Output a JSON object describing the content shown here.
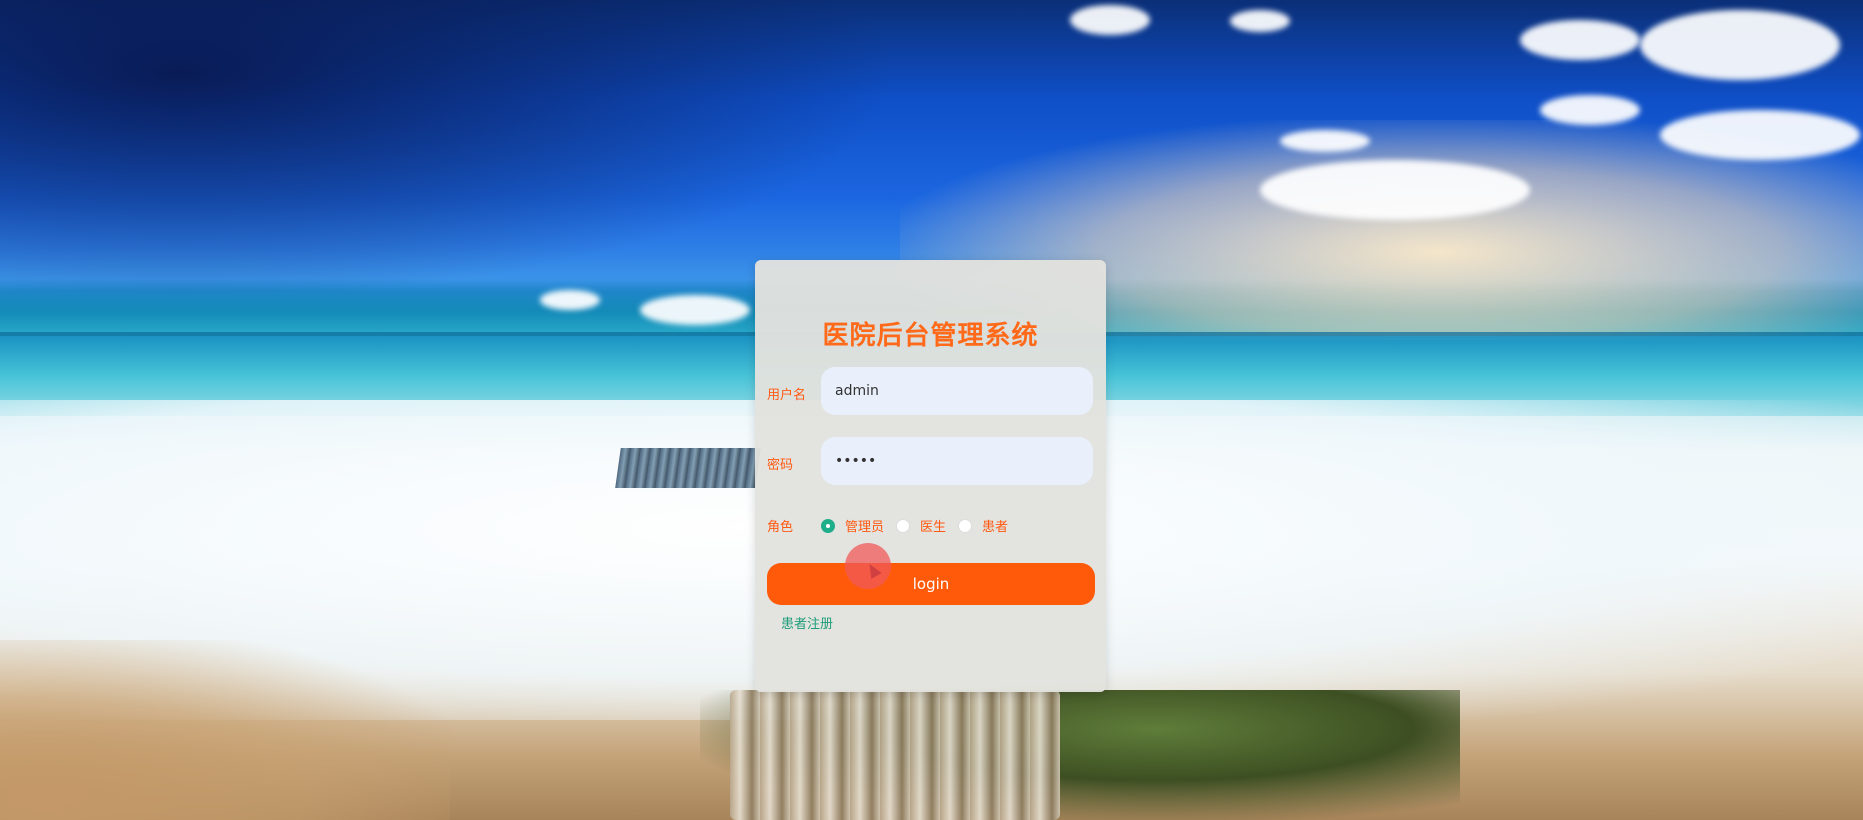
{
  "app": {
    "title": "医院后台管理系统"
  },
  "form": {
    "username_label": "用户名",
    "username_value": "admin",
    "password_label": "密码",
    "password_value": "•••••",
    "role_label": "角色",
    "roles": [
      {
        "label": "管理员",
        "checked": true
      },
      {
        "label": "医生",
        "checked": false
      },
      {
        "label": "患者",
        "checked": false
      }
    ],
    "login_label": "login",
    "register_link": "患者注册"
  },
  "colors": {
    "accent": "#ff5a0a",
    "title": "#ff6a1a",
    "link": "#1f9d7a",
    "radio_checked": "#1fae8a",
    "panel_bg": "#e2e2de",
    "input_bg": "#e9f0fb"
  }
}
